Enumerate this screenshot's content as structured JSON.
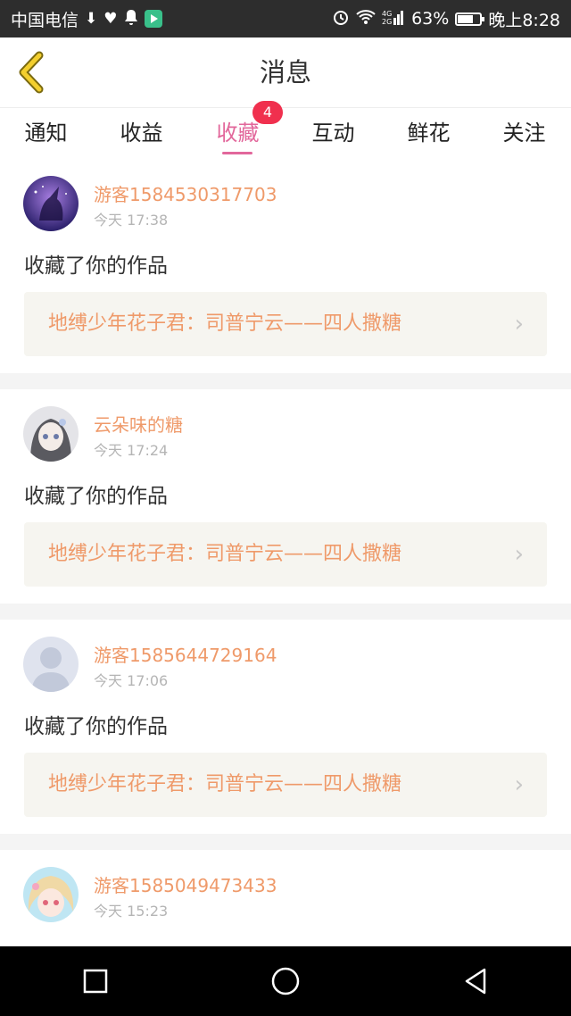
{
  "status_bar": {
    "carrier": "中国电信",
    "battery_percent": "63%",
    "battery_level": 0.63,
    "time": "晚上8:28",
    "icons": [
      "download-icon",
      "health-icon",
      "notification-bell-icon",
      "play-store-icon",
      "alarm-icon",
      "wifi-icon",
      "signal-4g-icon",
      "battery-icon"
    ]
  },
  "header": {
    "title": "消息",
    "back_icon": "chevron-left-icon"
  },
  "tabs": [
    {
      "label": "通知"
    },
    {
      "label": "收益"
    },
    {
      "label": "收藏",
      "active": true,
      "badge": "4"
    },
    {
      "label": "互动"
    },
    {
      "label": "鲜花"
    },
    {
      "label": "关注"
    }
  ],
  "accent_color": "#e2679b",
  "messages": [
    {
      "username": "游客1584530317703",
      "time": "今天 17:38",
      "text": "收藏了你的作品",
      "work_title": "地缚少年花子君：司普宁云——四人撒糖"
    },
    {
      "username": "云朵味的糖",
      "time": "今天 17:24",
      "text": "收藏了你的作品",
      "work_title": "地缚少年花子君：司普宁云——四人撒糖"
    },
    {
      "username": "游客1585644729164",
      "time": "今天 17:06",
      "text": "收藏了你的作品",
      "work_title": "地缚少年花子君：司普宁云——四人撒糖"
    },
    {
      "username": "游客1585049473433",
      "time": "今天 15:23"
    }
  ],
  "navbar": {
    "icons": [
      "square-recents-icon",
      "circle-home-icon",
      "triangle-back-icon"
    ]
  }
}
